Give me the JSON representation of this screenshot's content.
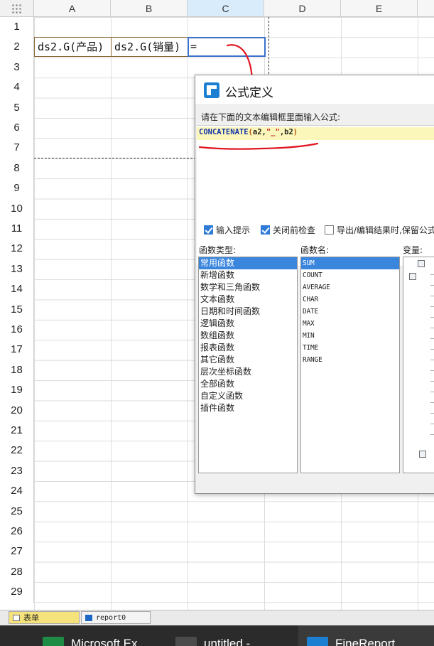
{
  "sheet": {
    "columns": [
      "A",
      "B",
      "C",
      "D",
      "E"
    ],
    "selected_column": "C",
    "rows": [
      "1",
      "2",
      "3",
      "4",
      "5",
      "6",
      "7",
      "8",
      "9",
      "10",
      "11",
      "12",
      "13",
      "14",
      "15",
      "16",
      "17",
      "18",
      "19",
      "20",
      "21",
      "22",
      "23",
      "24",
      "25",
      "26",
      "27",
      "28",
      "29"
    ],
    "cells": {
      "a2": "ds2.G(产品)",
      "b2": "ds2.G(销量)",
      "c2": "="
    }
  },
  "dialog": {
    "title": "公式定义",
    "prompt": "请在下面的文本编辑框里面输入公式:",
    "formula": {
      "function": "CONCATENATE",
      "open": "(",
      "arg1": "a2,",
      "string": "\"_\"",
      "arg2": ",b2",
      "close": ")"
    },
    "options": [
      {
        "label": "输入提示",
        "checked": true
      },
      {
        "label": "关闭前检查",
        "checked": true
      },
      {
        "label": "导出/编辑结果时,保留公式",
        "checked": false
      }
    ],
    "category_label": "函数类型:",
    "categories": [
      "常用函数",
      "新增函数",
      "数学和三角函数",
      "文本函数",
      "日期和时间函数",
      "逻辑函数",
      "数组函数",
      "报表函数",
      "其它函数",
      "层次坐标函数",
      "全部函数",
      "自定义函数",
      "插件函数"
    ],
    "selected_category": 0,
    "function_label": "函数名:",
    "functions": [
      "SUM",
      "COUNT",
      "AVERAGE",
      "CHAR",
      "DATE",
      "MAX",
      "MIN",
      "TIME",
      "RANGE"
    ],
    "selected_function": 0,
    "variable_label": "变量:"
  },
  "sheet_tabs": [
    "表单",
    "report0"
  ],
  "taskbar": {
    "items": [
      {
        "label": "Microsoft Ex",
        "icon": "excel-icon"
      },
      {
        "label": "untitled -",
        "icon": "sublime-icon"
      },
      {
        "label": "FineReport",
        "icon": "finereport-icon"
      }
    ]
  },
  "colors": {
    "selection_blue": "#3a86dd",
    "annotation_red": "#e0141e",
    "active_tab_yellow": "#f6e27b"
  }
}
